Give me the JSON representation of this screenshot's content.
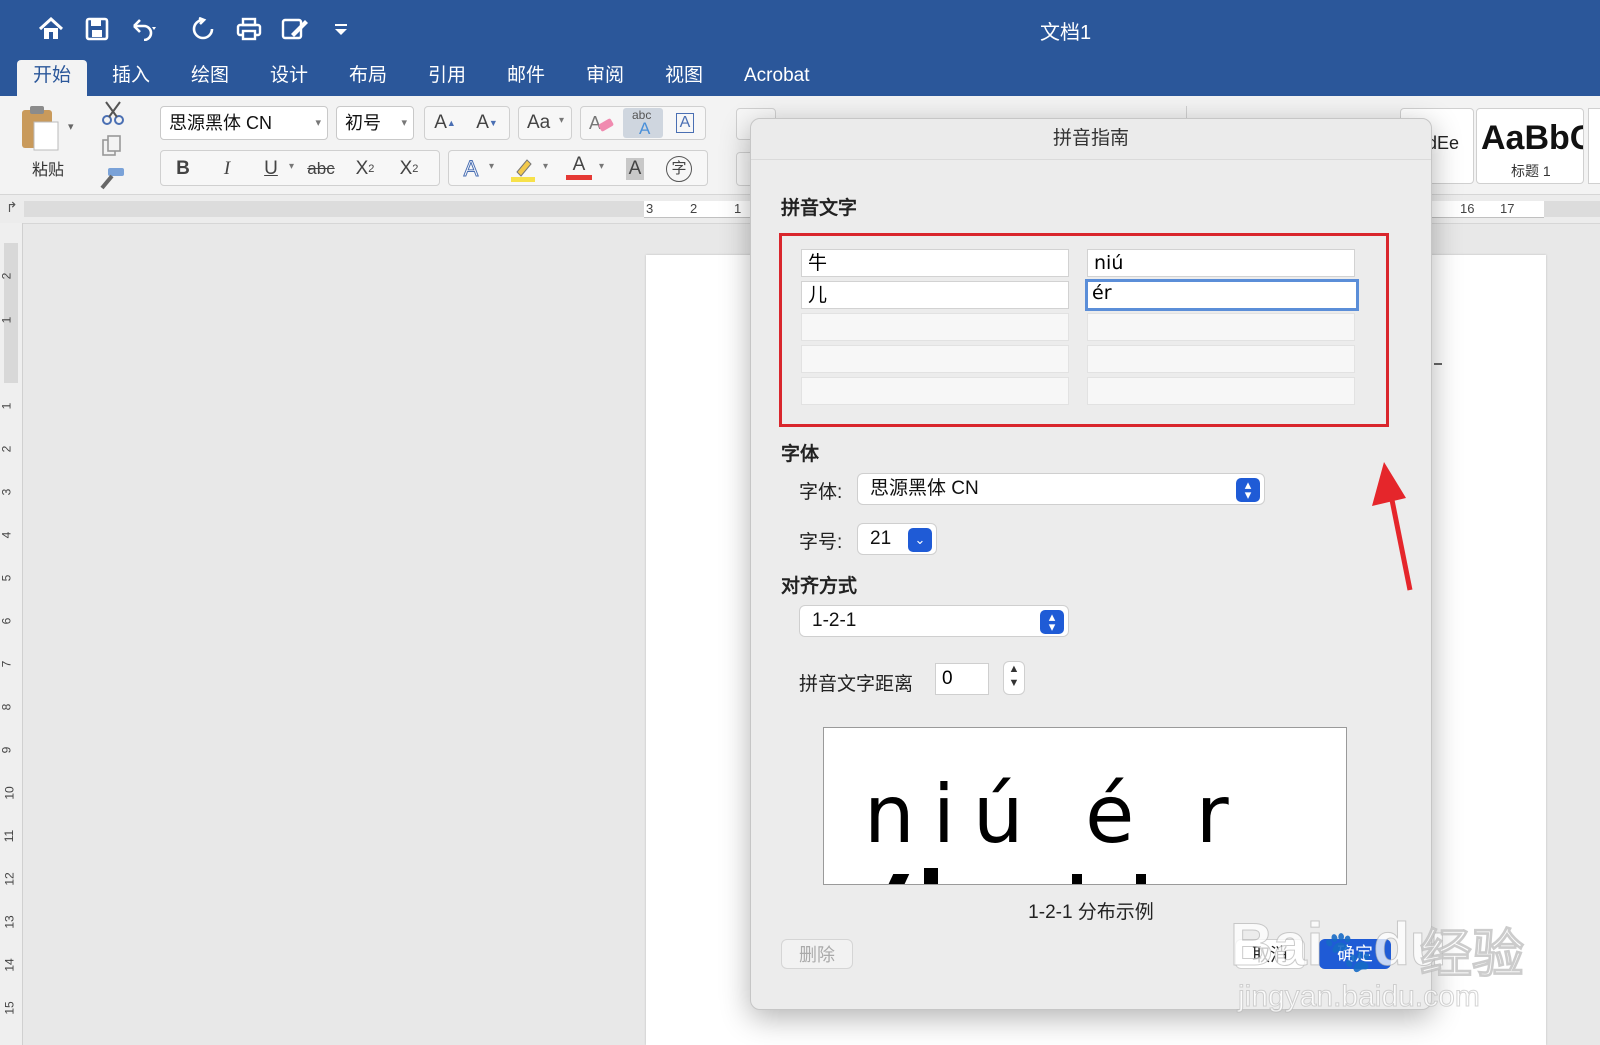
{
  "window": {
    "title": "文档1"
  },
  "quick_access": {
    "icons": [
      "home-icon",
      "save-icon",
      "undo-icon",
      "redo-icon",
      "print-icon",
      "edit-document-icon",
      "customize-icon"
    ]
  },
  "tabs": [
    {
      "label": "开始",
      "active": true
    },
    {
      "label": "插入"
    },
    {
      "label": "绘图"
    },
    {
      "label": "设计"
    },
    {
      "label": "布局"
    },
    {
      "label": "引用"
    },
    {
      "label": "邮件"
    },
    {
      "label": "审阅"
    },
    {
      "label": "视图"
    },
    {
      "label": "Acrobat"
    }
  ],
  "ribbon": {
    "paste_label": "粘贴",
    "font_name": "思源黑体 CN",
    "font_size": "初号",
    "grow_font": "A",
    "shrink_font": "A",
    "change_case": "Aa",
    "phonetic_abc": "abc",
    "phonetic_a": "A",
    "char_border": "A",
    "bold": "B",
    "italic": "I",
    "underline": "U",
    "strike": "abc",
    "subscript_base": "X",
    "subscript_mark": "2",
    "superscript_base": "X",
    "superscript_mark": "2",
    "text_effect": "A",
    "font_color": "A",
    "char_shading": "A",
    "enclose_char": "字",
    "style_sample_partial": "dEe",
    "style_sample": "AaBbC",
    "style_name": "标题 1"
  },
  "ruler": {
    "left_numbers": [
      "3",
      "2",
      "1"
    ],
    "right_numbers": [
      "16",
      "17"
    ],
    "vertical_numbers": [
      "2",
      "1",
      "1",
      "2",
      "3",
      "4",
      "5",
      "6",
      "7",
      "8",
      "9",
      "10",
      "11",
      "12",
      "13",
      "14",
      "15"
    ]
  },
  "dialog": {
    "title": "拼音指南",
    "section_text": "拼音文字",
    "rows": [
      {
        "base": "牛",
        "ruby": "niú"
      },
      {
        "base": "儿",
        "ruby": "ér"
      },
      {
        "base": "",
        "ruby": ""
      },
      {
        "base": "",
        "ruby": ""
      },
      {
        "base": "",
        "ruby": ""
      }
    ],
    "section_font": "字体",
    "font_label": "字体:",
    "font_value": "思源黑体 CN",
    "size_label": "字号:",
    "size_value": "21",
    "section_align": "对齐方式",
    "align_value": "1-2-1",
    "offset_label": "拼音文字距离",
    "offset_value": "0",
    "preview_text": "niú é r",
    "preview_caption": "1-2-1 分布示例",
    "delete_label": "删除",
    "cancel_label": "取消",
    "ok_label": "确定"
  },
  "watermark": {
    "brand": "Bai",
    "brand_tail": "du",
    "cn": "经验",
    "url": "jingyan.baidu.com"
  },
  "colors": {
    "title_bar": "#2b579a",
    "highlight_box": "#d9262c",
    "arrow": "#e5262b",
    "primary_button": "#1f5bd6"
  }
}
